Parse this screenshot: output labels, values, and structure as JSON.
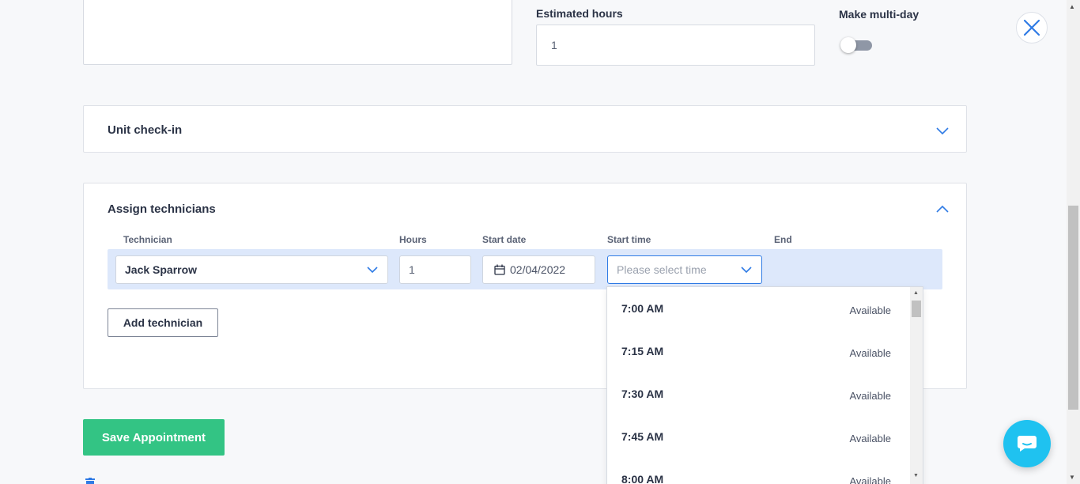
{
  "top": {
    "estimated_hours_label": "Estimated hours",
    "estimated_hours_value": "1",
    "multi_day_label": "Make multi-day",
    "multi_day_enabled": false
  },
  "unit_checkin": {
    "title": "Unit check-in",
    "expanded": false
  },
  "assign": {
    "title": "Assign technicians",
    "expanded": true,
    "columns": {
      "technician": "Technician",
      "hours": "Hours",
      "start_date": "Start date",
      "start_time": "Start time",
      "end": "End"
    },
    "row": {
      "technician": "Jack Sparrow",
      "hours": "1",
      "start_date": "02/04/2022",
      "start_time_placeholder": "Please select time"
    },
    "add_button": "Add technician"
  },
  "time_options": [
    {
      "time": "7:00 AM",
      "status": "Available"
    },
    {
      "time": "7:15 AM",
      "status": "Available"
    },
    {
      "time": "7:30 AM",
      "status": "Available"
    },
    {
      "time": "7:45 AM",
      "status": "Available"
    },
    {
      "time": "8:00 AM",
      "status": "Available"
    }
  ],
  "save_button": "Save Appointment",
  "colors": {
    "accent": "#2f7be5",
    "save": "#33c484",
    "chat": "#1fc2f0",
    "row_highlight": "#dde8fb"
  },
  "icons": [
    "close-icon",
    "chevron-down-icon",
    "chevron-up-icon",
    "calendar-icon",
    "chat-icon",
    "trash-icon"
  ]
}
